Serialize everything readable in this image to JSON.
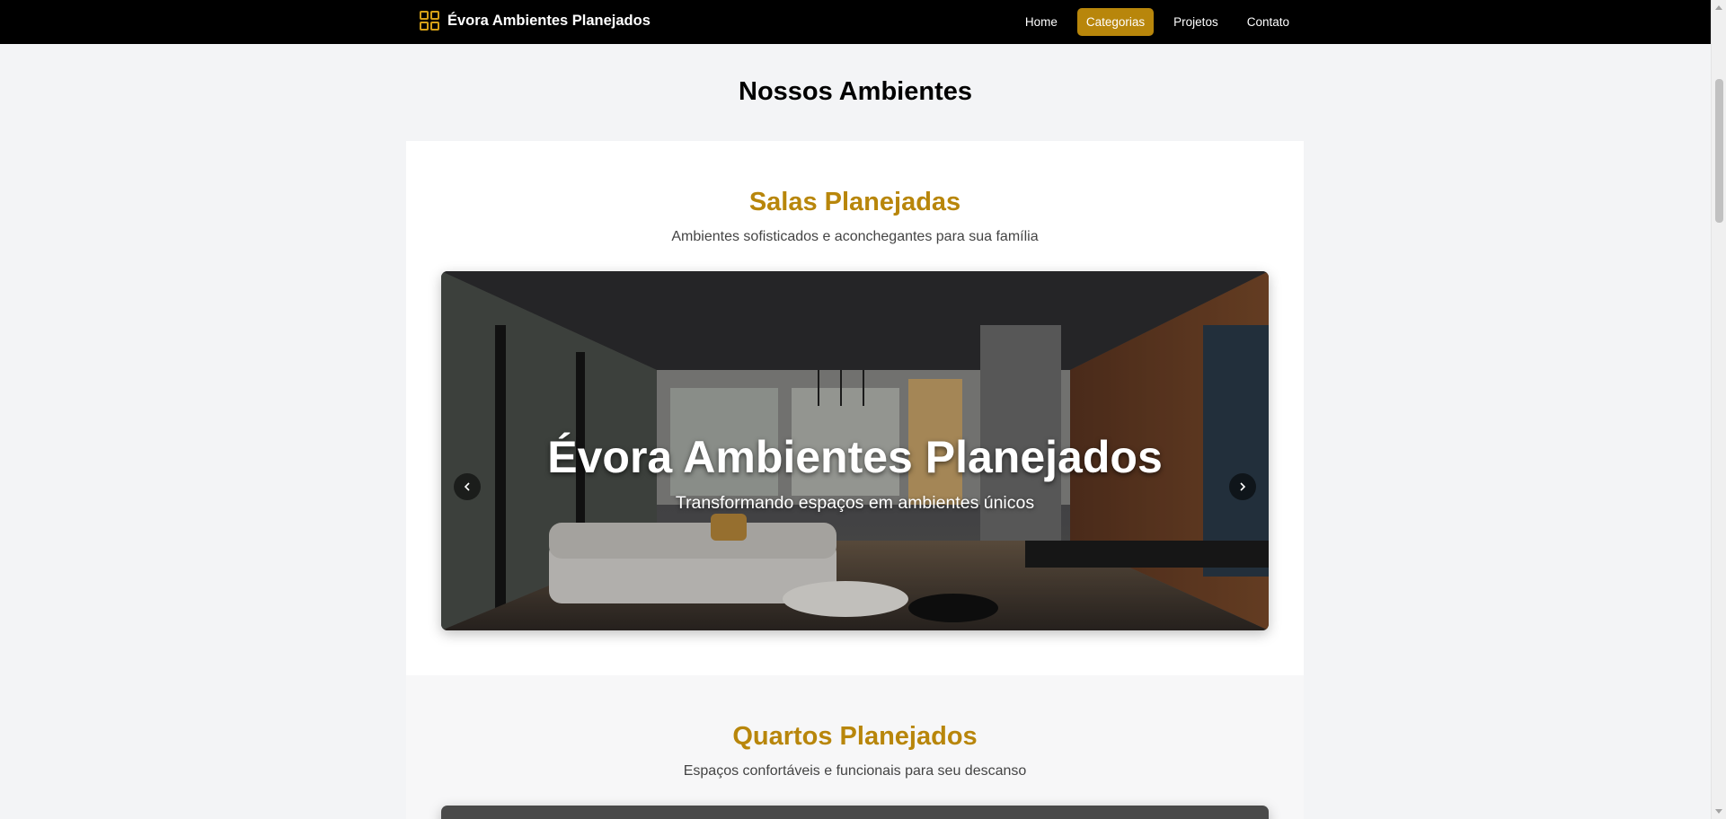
{
  "nav": {
    "brand": "Évora Ambientes Planejados",
    "brand_icon": "grid-icon",
    "links": [
      {
        "label": "Home",
        "active": false
      },
      {
        "label": "Categorias",
        "active": true
      },
      {
        "label": "Projetos",
        "active": false
      },
      {
        "label": "Contato",
        "active": false
      }
    ]
  },
  "page": {
    "title": "Nossos Ambientes"
  },
  "sections": [
    {
      "title": "Salas Planejadas",
      "subtitle": "Ambientes sofisticados e aconchegantes para sua família",
      "carousel": {
        "caption_title": "Évora Ambientes Planejados",
        "caption_subtitle": "Transformando espaços em ambientes únicos",
        "prev_icon": "chevron-left-icon",
        "next_icon": "chevron-right-icon"
      }
    },
    {
      "title": "Quartos Planejados",
      "subtitle": "Espaços confortáveis e funcionais para seu descanso"
    }
  ],
  "colors": {
    "accent": "#b8860b",
    "navbar": "#000000",
    "page_bg": "#f3f4f6"
  }
}
